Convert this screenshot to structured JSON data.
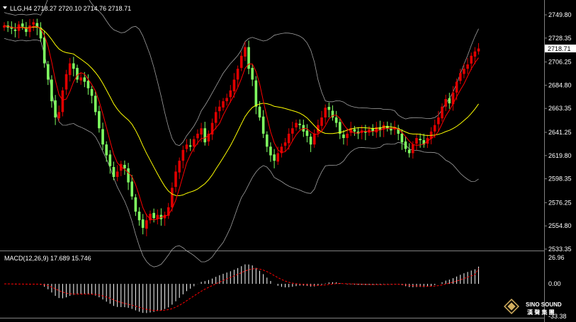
{
  "header": {
    "symbol_info": "LLG,H4  2718.27 2720.10 2714.76 2718.71"
  },
  "macd_header": "MACD(12,26,9) 17.689 15.746",
  "current_price": "2718.71",
  "price_axis_labels": [
    "2749.80",
    "2728.35",
    "2706.25",
    "2684.80",
    "2663.35",
    "2641.25",
    "2619.80",
    "2598.35",
    "2576.25",
    "2554.80",
    "2533.35"
  ],
  "macd_axis_labels": [
    "26.96",
    "0.00",
    "-33.38"
  ],
  "logo": {
    "brand": "SINO SOUND",
    "sub": "漢 聲 集 團"
  },
  "colors": {
    "background": "#000000",
    "bull": "#e00000",
    "bear": "#7fff60",
    "ma_fast": "#ffff00",
    "ma_slow": "#ff0000",
    "bands": "#a0a0a0",
    "macd_hist": "#ffffff",
    "macd_signal": "#ff0000",
    "text": "#ffffff"
  },
  "chart_data": {
    "type": "candlestick",
    "title": "LLG,H4",
    "ohlc_last": {
      "open": 2718.27,
      "high": 2720.1,
      "low": 2714.76,
      "close": 2718.71
    },
    "ylim": [
      2533.35,
      2749.8
    ],
    "closes": [
      2740,
      2738,
      2737,
      2735,
      2741,
      2739,
      2734,
      2740,
      2743,
      2738,
      2728,
      2705,
      2690,
      2670,
      2655,
      2660,
      2680,
      2695,
      2705,
      2700,
      2690,
      2692,
      2688,
      2682,
      2675,
      2660,
      2645,
      2630,
      2620,
      2610,
      2600,
      2605,
      2612,
      2608,
      2595,
      2582,
      2568,
      2560,
      2553,
      2560,
      2566,
      2562,
      2565,
      2561,
      2565,
      2572,
      2590,
      2605,
      2615,
      2625,
      2630,
      2628,
      2635,
      2640,
      2645,
      2632,
      2640,
      2650,
      2660,
      2665,
      2670,
      2673,
      2680,
      2690,
      2700,
      2712,
      2720,
      2700,
      2690,
      2665,
      2655,
      2640,
      2628,
      2620,
      2615,
      2622,
      2628,
      2632,
      2640,
      2645,
      2650,
      2648,
      2642,
      2638,
      2630,
      2640,
      2648,
      2655,
      2664,
      2662,
      2655,
      2650,
      2640,
      2636,
      2640,
      2645,
      2642,
      2640,
      2643,
      2641,
      2644,
      2642,
      2646,
      2643,
      2648,
      2645,
      2643,
      2646,
      2640,
      2632,
      2626,
      2622,
      2630,
      2636,
      2634,
      2630,
      2636,
      2642,
      2648,
      2655,
      2665,
      2672,
      2668,
      2678,
      2688,
      2696,
      2700,
      2704,
      2712,
      2716,
      2718.71
    ],
    "macd_range": [
      -33.38,
      26.96
    ],
    "macd_last": 17.689,
    "signal_last": 15.746
  }
}
